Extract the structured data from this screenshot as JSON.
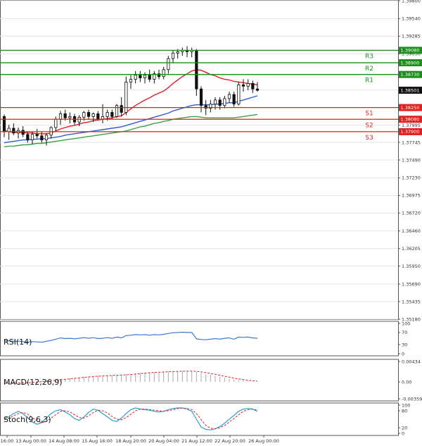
{
  "chart_data": {
    "type": "candlestick",
    "price_axis": {
      "ticks": [
        "1.39800",
        "1.39540",
        "1.39285",
        "1.39030",
        "1.38505",
        "1.37995",
        "1.37745",
        "1.37490",
        "1.37230",
        "1.36975",
        "1.36720",
        "1.36460",
        "1.36205",
        "1.35950",
        "1.35690",
        "1.35435",
        "1.35180"
      ],
      "current_price": "1.38501",
      "ylim": [
        1.3518,
        1.398
      ]
    },
    "time_axis": {
      "labels": [
        "16:00",
        "13 Aug 00:00",
        "14 Aug 08:00",
        "15 Aug 16:00",
        "18 Aug 20:00",
        "20 Aug 04:00",
        "21 Aug 12:00",
        "22 Aug 20:00",
        "26 Aug 00:00"
      ]
    },
    "levels": [
      {
        "name": "R3",
        "price": 1.3908,
        "label": "1.39080",
        "color": "#1e8c1e"
      },
      {
        "name": "R2",
        "price": 1.389,
        "label": "1.38900",
        "color": "#1e8c1e"
      },
      {
        "name": "R1",
        "price": 1.3873,
        "label": "1.38730",
        "color": "#1e8c1e"
      },
      {
        "name": "S1",
        "price": 1.3825,
        "label": "1.38250",
        "color": "#e02020"
      },
      {
        "name": "S2",
        "price": 1.3808,
        "label": "1.38080",
        "color": "#e02020"
      },
      {
        "name": "S3",
        "price": 1.379,
        "label": "1.37900",
        "color": "#e02020"
      }
    ],
    "candles": [
      [
        1.3812,
        1.3815,
        1.3782,
        1.379
      ],
      [
        1.379,
        1.38,
        1.3778,
        1.3795
      ],
      [
        1.3795,
        1.3802,
        1.3785,
        1.3788
      ],
      [
        1.3788,
        1.3796,
        1.378,
        1.3792
      ],
      [
        1.3792,
        1.3798,
        1.3782,
        1.3786
      ],
      [
        1.3786,
        1.379,
        1.3774,
        1.3778
      ],
      [
        1.3778,
        1.379,
        1.3772,
        1.3786
      ],
      [
        1.3786,
        1.3794,
        1.378,
        1.3784
      ],
      [
        1.3784,
        1.379,
        1.3774,
        1.3778
      ],
      [
        1.3778,
        1.3788,
        1.377,
        1.3785
      ],
      [
        1.3785,
        1.3798,
        1.378,
        1.3796
      ],
      [
        1.3796,
        1.3812,
        1.379,
        1.3808
      ],
      [
        1.3808,
        1.382,
        1.38,
        1.3816
      ],
      [
        1.3816,
        1.3822,
        1.3806,
        1.381
      ],
      [
        1.381,
        1.3818,
        1.3802,
        1.3812
      ],
      [
        1.3812,
        1.3816,
        1.38,
        1.3804
      ],
      [
        1.3804,
        1.3814,
        1.3798,
        1.3811
      ],
      [
        1.3811,
        1.382,
        1.3806,
        1.3818
      ],
      [
        1.3818,
        1.3822,
        1.3808,
        1.3812
      ],
      [
        1.3812,
        1.3818,
        1.3804,
        1.3816
      ],
      [
        1.3816,
        1.382,
        1.3806,
        1.3808
      ],
      [
        1.3808,
        1.383,
        1.3802,
        1.3812
      ],
      [
        1.3812,
        1.3822,
        1.3806,
        1.3818
      ],
      [
        1.3818,
        1.3822,
        1.3808,
        1.3812
      ],
      [
        1.3812,
        1.383,
        1.381,
        1.3828
      ],
      [
        1.3828,
        1.384,
        1.3812,
        1.3818
      ],
      [
        1.3818,
        1.387,
        1.3814,
        1.3862
      ],
      [
        1.3862,
        1.3872,
        1.3852,
        1.3866
      ],
      [
        1.3866,
        1.3878,
        1.386,
        1.3872
      ],
      [
        1.3872,
        1.3878,
        1.3862,
        1.3868
      ],
      [
        1.3868,
        1.3876,
        1.386,
        1.3872
      ],
      [
        1.3872,
        1.388,
        1.3862,
        1.3866
      ],
      [
        1.3866,
        1.3878,
        1.386,
        1.3874
      ],
      [
        1.3874,
        1.388,
        1.3866,
        1.387
      ],
      [
        1.387,
        1.3884,
        1.3866,
        1.388
      ],
      [
        1.388,
        1.39,
        1.3874,
        1.3896
      ],
      [
        1.3896,
        1.3908,
        1.389,
        1.3904
      ],
      [
        1.3904,
        1.391,
        1.3896,
        1.3906
      ],
      [
        1.3906,
        1.3912,
        1.39,
        1.3908
      ],
      [
        1.3908,
        1.3914,
        1.3898,
        1.3906
      ],
      [
        1.3906,
        1.3912,
        1.3898,
        1.3908
      ],
      [
        1.3908,
        1.391,
        1.3842,
        1.3852
      ],
      [
        1.3852,
        1.3856,
        1.3818,
        1.3828
      ],
      [
        1.3828,
        1.3836,
        1.3814,
        1.3824
      ],
      [
        1.3824,
        1.3836,
        1.3818,
        1.383
      ],
      [
        1.383,
        1.384,
        1.3822,
        1.3836
      ],
      [
        1.3836,
        1.384,
        1.3822,
        1.3828
      ],
      [
        1.3828,
        1.3842,
        1.3824,
        1.3838
      ],
      [
        1.3838,
        1.3848,
        1.3832,
        1.3844
      ],
      [
        1.3844,
        1.3848,
        1.3826,
        1.383
      ],
      [
        1.383,
        1.3862,
        1.3828,
        1.3858
      ],
      [
        1.3858,
        1.3866,
        1.3848,
        1.3856
      ],
      [
        1.3856,
        1.3866,
        1.385,
        1.386
      ],
      [
        1.386,
        1.3864,
        1.3846,
        1.3852
      ],
      [
        1.3852,
        1.3862,
        1.3848,
        1.385
      ]
    ],
    "moving_averages": [
      {
        "color": "#e02020",
        "values": [
          1.3792,
          1.379,
          1.3789,
          1.3789,
          1.3789,
          1.3788,
          1.3788,
          1.3787,
          1.3787,
          1.3787,
          1.3788,
          1.3791,
          1.3794,
          1.3796,
          1.3798,
          1.3799,
          1.3801,
          1.3803,
          1.3804,
          1.3806,
          1.3807,
          1.3808,
          1.3809,
          1.381,
          1.3812,
          1.3813,
          1.3818,
          1.3823,
          1.3828,
          1.3832,
          1.3836,
          1.3839,
          1.3843,
          1.3846,
          1.3849,
          1.3854,
          1.386,
          1.3865,
          1.387,
          1.3874,
          1.3878,
          1.388,
          1.3879,
          1.3876,
          1.3873,
          1.3871,
          1.3868,
          1.3866,
          1.3865,
          1.3863,
          1.3862,
          1.3861,
          1.386,
          1.3859,
          1.3858
        ]
      },
      {
        "color": "#2f5fcf",
        "values": [
          1.3774,
          1.3775,
          1.3776,
          1.3777,
          1.3778,
          1.3778,
          1.3779,
          1.3779,
          1.378,
          1.378,
          1.3781,
          1.3782,
          1.3783,
          1.3785,
          1.3786,
          1.3787,
          1.3788,
          1.3789,
          1.379,
          1.3791,
          1.3792,
          1.3793,
          1.3794,
          1.3795,
          1.3796,
          1.3797,
          1.3799,
          1.3801,
          1.3803,
          1.3805,
          1.3807,
          1.3809,
          1.3811,
          1.3813,
          1.3815,
          1.3817,
          1.382,
          1.3822,
          1.3824,
          1.3826,
          1.3828,
          1.3829,
          1.3829,
          1.3829,
          1.3829,
          1.383,
          1.383,
          1.3831,
          1.3832,
          1.3832,
          1.3834,
          1.3836,
          1.3838,
          1.384,
          1.3842
        ]
      },
      {
        "color": "#3aa14a",
        "values": [
          1.3768,
          1.3769,
          1.3769,
          1.377,
          1.3771,
          1.3771,
          1.3772,
          1.3773,
          1.3773,
          1.3774,
          1.3775,
          1.3776,
          1.3777,
          1.3778,
          1.3779,
          1.378,
          1.3781,
          1.3782,
          1.3783,
          1.3784,
          1.3785,
          1.3786,
          1.3787,
          1.3788,
          1.3789,
          1.379,
          1.3791,
          1.3793,
          1.3795,
          1.3797,
          1.3798,
          1.38,
          1.3802,
          1.3803,
          1.3805,
          1.3806,
          1.3808,
          1.3809,
          1.381,
          1.3811,
          1.3812,
          1.3812,
          1.3811,
          1.381,
          1.381,
          1.381,
          1.381,
          1.381,
          1.381,
          1.381,
          1.3811,
          1.3812,
          1.3813,
          1.3814,
          1.3815
        ]
      }
    ],
    "indicators": [
      {
        "name": "RSI(14)",
        "axis_labels": [
          "100",
          "70",
          "30",
          "0"
        ],
        "ylim": [
          0,
          100
        ],
        "color": "#3a7bd5",
        "values": [
          44,
          42,
          41,
          41,
          40,
          38,
          40,
          39,
          38,
          41,
          44,
          48,
          52,
          50,
          51,
          49,
          51,
          53,
          51,
          53,
          50,
          51,
          53,
          51,
          55,
          52,
          60,
          61,
          63,
          62,
          63,
          61,
          63,
          62,
          64,
          67,
          69,
          70,
          71,
          70,
          70,
          49,
          47,
          46,
          48,
          50,
          48,
          51,
          52,
          48,
          55,
          54,
          55,
          52,
          51
        ]
      },
      {
        "name": "MACD(12,26,9)",
        "axis_labels": [
          "0.00434",
          "0.00",
          "-0.003592"
        ],
        "ylim": [
          -0.003592,
          0.00434
        ],
        "color": "#e02020",
        "values": [
          -0.0003,
          -0.0003,
          -0.0003,
          -0.0002,
          -0.0002,
          -0.0001,
          0.0,
          0.0001,
          0.0002,
          0.0003,
          0.0004,
          0.0005,
          0.0006,
          0.0007,
          0.0008,
          0.0009,
          0.001,
          0.0011,
          0.0012,
          0.0012,
          0.0013,
          0.0013,
          0.0014,
          0.0014,
          0.0015,
          0.0015,
          0.0016,
          0.0017,
          0.0018,
          0.0019,
          0.002,
          0.002,
          0.0021,
          0.0021,
          0.0022,
          0.0022,
          0.0022,
          0.0023,
          0.0023,
          0.0023,
          0.0022,
          0.0021,
          0.0019,
          0.0017,
          0.0015,
          0.0013,
          0.0011,
          0.0009,
          0.0007,
          0.0005,
          0.0004,
          0.0003,
          0.0002,
          0.0001,
          0.0
        ]
      },
      {
        "name": "Stoch(9,6,3)",
        "axis_labels": [
          "100",
          "80",
          "20",
          "0"
        ],
        "ylim": [
          0,
          100
        ],
        "main": [
          52,
          60,
          70,
          78,
          70,
          55,
          40,
          32,
          38,
          55,
          70,
          80,
          84,
          76,
          66,
          52,
          46,
          58,
          74,
          86,
          82,
          70,
          58,
          46,
          42,
          54,
          70,
          84,
          90,
          86,
          84,
          82,
          78,
          76,
          78,
          84,
          88,
          90,
          90,
          86,
          78,
          50,
          22,
          14,
          12,
          16,
          24,
          36,
          50,
          64,
          78,
          86,
          88,
          86,
          78
        ],
        "signal": [
          48,
          54,
          62,
          70,
          74,
          68,
          56,
          44,
          38,
          42,
          54,
          66,
          78,
          80,
          76,
          66,
          56,
          54,
          62,
          74,
          82,
          80,
          72,
          60,
          50,
          48,
          56,
          68,
          80,
          86,
          86,
          84,
          82,
          80,
          78,
          80,
          84,
          88,
          90,
          88,
          84,
          70,
          48,
          28,
          18,
          16,
          20,
          28,
          40,
          52,
          66,
          78,
          84,
          86,
          82
        ]
      }
    ]
  }
}
